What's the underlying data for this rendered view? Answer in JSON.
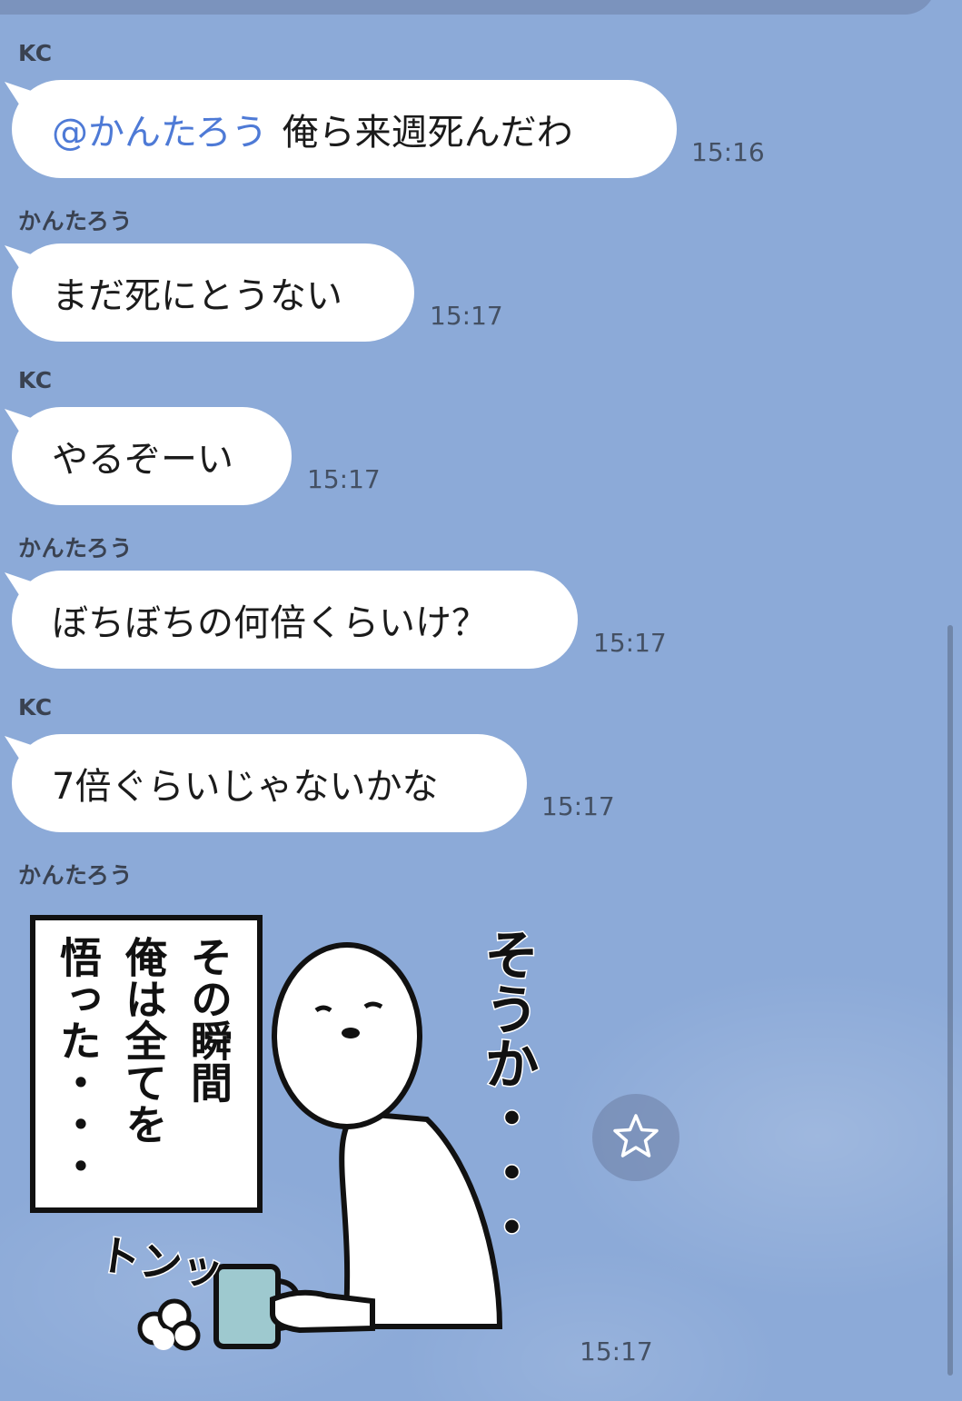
{
  "messages": [
    {
      "sender": "KC",
      "mention": "@かんたろう",
      "text": "俺ら来週死んだわ",
      "time": "15:16"
    },
    {
      "sender": "かんたろう",
      "text": "まだ死にとうない",
      "time": "15:17"
    },
    {
      "sender": "KC",
      "text": "やるぞーい",
      "time": "15:17"
    },
    {
      "sender": "かんたろう",
      "text": "ぼちぼちの何倍くらいけ？",
      "time": "15:17"
    },
    {
      "sender": "KC",
      "text": "7倍ぐらいじゃないかな",
      "time": "15:17"
    },
    {
      "sender": "かんたろう",
      "time": "15:17"
    }
  ],
  "sticker": {
    "box_text": [
      "その瞬間",
      "俺は全てを",
      "悟った・・・"
    ],
    "side_text": "そうか・・・",
    "sound_text": "トンッ"
  },
  "icons": {
    "favorite": "star-icon"
  },
  "colors": {
    "background": "#8caad8",
    "bubble": "#ffffff",
    "mention": "#4e7ad6"
  }
}
